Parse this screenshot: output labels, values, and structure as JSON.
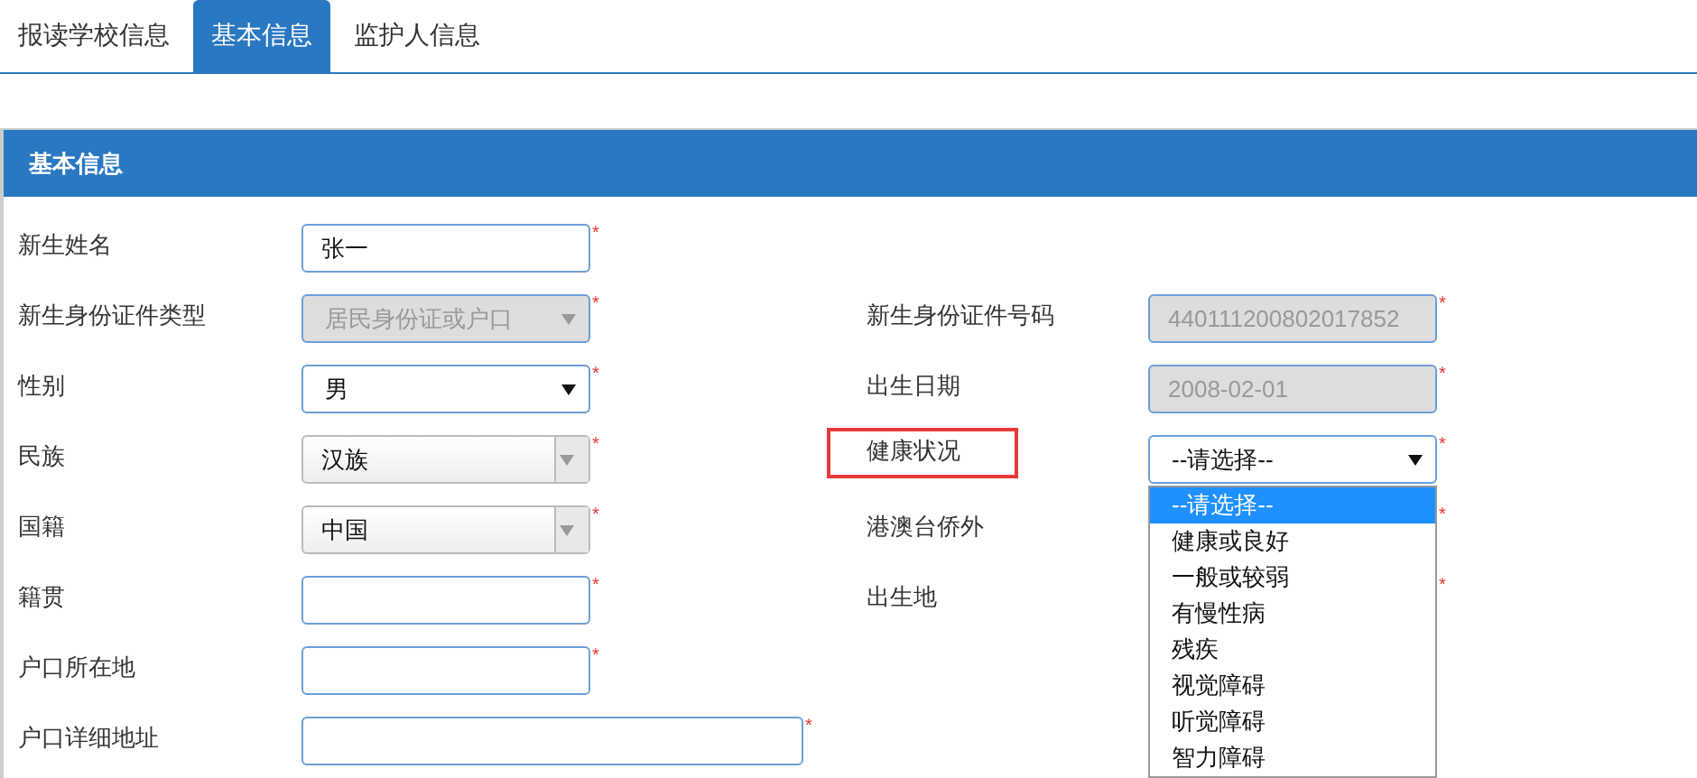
{
  "tabs": [
    {
      "label": "报读学校信息",
      "selected": false
    },
    {
      "label": "基本信息",
      "selected": true
    },
    {
      "label": "监护人信息",
      "selected": false
    }
  ],
  "panel": {
    "title": "基本信息"
  },
  "rows": [
    {
      "left": {
        "label": "新生姓名",
        "kind": "text",
        "value": "张一",
        "mark": "*"
      },
      "right": null
    },
    {
      "left": {
        "label": "新生身份证件类型",
        "kind": "select",
        "value": "居民身份证或户口",
        "disabled": true,
        "mark": "*"
      },
      "right": {
        "label": "新生身份证件号码",
        "kind": "text",
        "value": "440111200802017852",
        "disabled": true,
        "mark": "*"
      }
    },
    {
      "left": {
        "label": "性别",
        "kind": "select",
        "value": "男",
        "disabled": false,
        "mark": "*"
      },
      "right": {
        "label": "出生日期",
        "kind": "text",
        "value": "2008-02-01",
        "disabled": true,
        "mark": "*"
      }
    },
    {
      "left": {
        "label": "民族",
        "kind": "combo",
        "value": "汉族",
        "mark": "*"
      },
      "right": {
        "label": "健康状况",
        "kind": "select",
        "value": "--请选择--",
        "disabled": false,
        "mark": "*",
        "highlight": true,
        "open": true,
        "options": [
          {
            "label": "--请选择--",
            "selected": true
          },
          {
            "label": "健康或良好",
            "selected": false
          },
          {
            "label": "一般或较弱",
            "selected": false
          },
          {
            "label": "有慢性病",
            "selected": false
          },
          {
            "label": "残疾",
            "selected": false
          },
          {
            "label": "视觉障碍",
            "selected": false
          },
          {
            "label": "听觉障碍",
            "selected": false
          },
          {
            "label": "智力障碍",
            "selected": false
          }
        ]
      }
    },
    {
      "left": {
        "label": "国籍",
        "kind": "combo",
        "value": "中国",
        "mark": "*"
      },
      "right": {
        "label": "港澳台侨外",
        "kind": "hidden",
        "mark": "*"
      }
    },
    {
      "left": {
        "label": "籍贯",
        "kind": "text",
        "mark": "*"
      },
      "right": {
        "label": "出生地",
        "kind": "hidden",
        "mark": "*"
      }
    },
    {
      "left": {
        "label": "户口所在地",
        "kind": "text",
        "mark": "*"
      },
      "right": null
    },
    {
      "left": {
        "label": "户口详细地址",
        "kind": "text",
        "mark": "*",
        "wide": true
      },
      "right": null
    }
  ]
}
